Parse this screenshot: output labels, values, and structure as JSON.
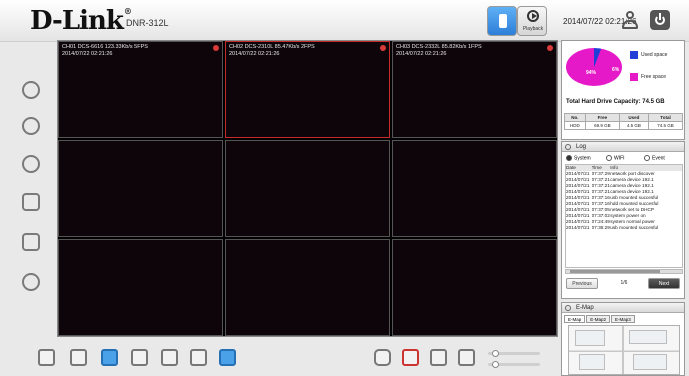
{
  "header": {
    "logo": "D-Link",
    "model": "DNR-312L",
    "modes": {
      "live": "",
      "playback": "Playback"
    },
    "datetime": "2014/07/22 02:21:26",
    "icons": {
      "user": "user-icon",
      "power": "power-icon"
    }
  },
  "left_toolbar": [
    "pin-icon",
    "settings-icon",
    "search-icon",
    "monitor-icon",
    "backup-icon",
    "info-icon"
  ],
  "cameras": [
    {
      "line1": "CH01  DCS-6616  123.33Kb/s  5FPS",
      "line2": "2014/07/22  02:21:26",
      "selected": false
    },
    {
      "line1": "CH02  DCS-2310L  85.47Kb/s  2FPS",
      "line2": "2014/07/22  02:21:26",
      "selected": true
    },
    {
      "line1": "CH03  DCS-2332L  85.82Kb/s  1FPS",
      "line2": "2014/07/22  02:21:26",
      "selected": false
    },
    {
      "line1": "",
      "line2": "",
      "selected": false
    },
    {
      "line1": "",
      "line2": "",
      "selected": false
    },
    {
      "line1": "",
      "line2": "",
      "selected": false
    },
    {
      "line1": "",
      "line2": "",
      "selected": false
    },
    {
      "line1": "",
      "line2": "",
      "selected": false
    },
    {
      "line1": "",
      "line2": "",
      "selected": false
    }
  ],
  "disk": {
    "pie_free_pct": "94%",
    "pie_used_pct": "6%",
    "used_fraction": 0.06,
    "legend_used": "Used space",
    "legend_free": "Free space",
    "colors": {
      "used": "#1f3fd6",
      "free": "#e619c9"
    },
    "capacity_label": "Total Hard Drive Capacity: 74.5 GB",
    "table": {
      "headers": [
        "No.",
        "Free",
        "Used",
        "Total"
      ],
      "row": [
        "HDD",
        "69.9 GB",
        "4.5 GB",
        "74.5 GB"
      ]
    }
  },
  "log": {
    "title": "Log",
    "tabs": [
      "System",
      "WIFI",
      "Event"
    ],
    "headers": [
      "Date",
      "Time",
      "Info"
    ],
    "rows": [
      [
        "2014/07/21",
        "07:37:29",
        "network port discover"
      ],
      [
        "2014/07/21",
        "07:37:21",
        "camera device 192.1"
      ],
      [
        "2014/07/21",
        "07:37:21",
        "camera device 192.1"
      ],
      [
        "2014/07/21",
        "07:37:21",
        "camera device 192.1"
      ],
      [
        "2014/07/21",
        "07:37:16",
        "usb mounted succesful"
      ],
      [
        "2014/07/21",
        "07:37:16",
        "hdd mounted succesful"
      ],
      [
        "2014/07/21",
        "07:37:05",
        "network set to DHCP"
      ],
      [
        "2014/07/21",
        "07:37:02",
        "system power on"
      ],
      [
        "2014/07/21",
        "07:24:49",
        "system normal power"
      ],
      [
        "2014/07/21",
        "07:36:29",
        "usb mounted succesful"
      ]
    ],
    "prev_label": "Previous",
    "page": "1/6",
    "next_label": "Next"
  },
  "emap": {
    "title": "E-Map",
    "tabs": [
      "E-Map",
      "E-Map2",
      "E-Map3"
    ]
  },
  "bottom_toolbar": {
    "layout_icons": [
      "layout-1x1-icon",
      "layout-2x2-icon",
      "layout-3x3-icon",
      "layout-custom-icon",
      "layout-stack-icon",
      "layout-patrol-icon",
      "fullscreen-icon"
    ],
    "action_icons": [
      "snapshot-icon",
      "record-icon",
      "zoom-icon",
      "ptz-icon"
    ],
    "active_layout": "layout-3x3-icon"
  }
}
